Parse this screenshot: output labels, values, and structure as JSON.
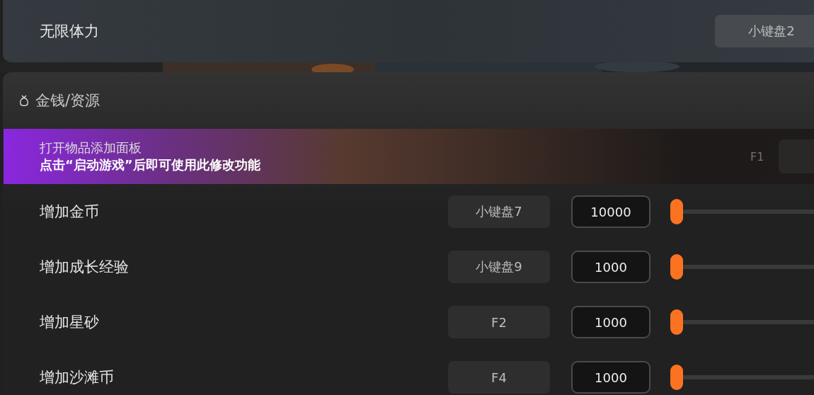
{
  "top_item": {
    "label": "无限体力",
    "hotkey": "小键盘2"
  },
  "section": {
    "title": "金钱/资源"
  },
  "banner": {
    "title": "打开物品添加面板",
    "notice": "点击“启动游戏”后即可使用此修改功能",
    "hotkey": "F1"
  },
  "rows": [
    {
      "label": "增加金币",
      "hotkey": "小键盘7",
      "value": "10000",
      "level": 0
    },
    {
      "label": "增加成长经验",
      "hotkey": "小键盘9",
      "value": "1000",
      "level": 0
    },
    {
      "label": "增加星砂",
      "hotkey": "F2",
      "value": "1000",
      "level": 0
    },
    {
      "label": "增加沙滩币",
      "hotkey": "F4",
      "value": "1000",
      "level": 0
    }
  ]
}
